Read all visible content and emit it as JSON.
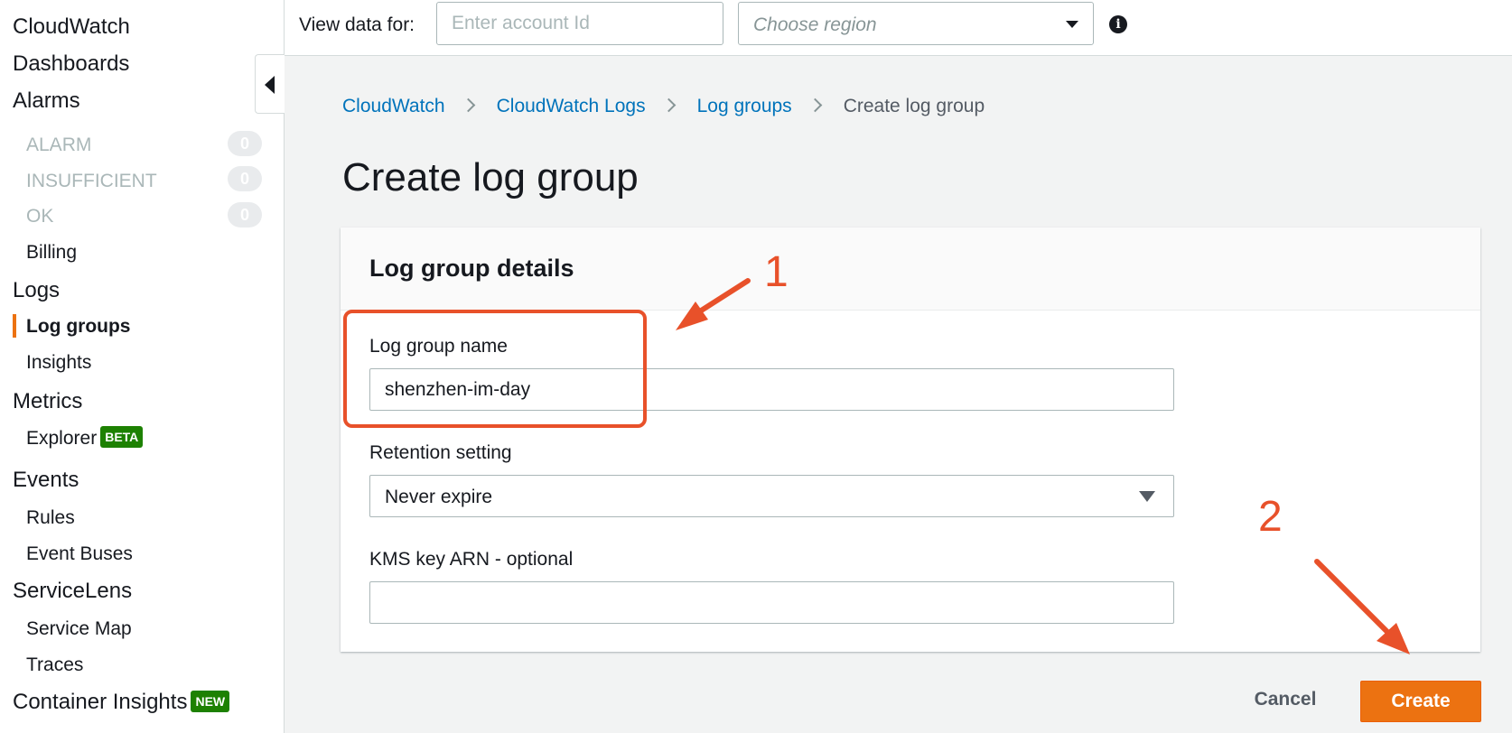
{
  "topbar": {
    "view_data_label": "View data for:",
    "account_placeholder": "Enter account Id",
    "region_placeholder": "Choose region"
  },
  "sidebar": {
    "cloudwatch": "CloudWatch",
    "dashboards": "Dashboards",
    "alarms": "Alarms",
    "alarm_items": [
      {
        "label": "ALARM",
        "count": "0"
      },
      {
        "label": "INSUFFICIENT",
        "count": "0"
      },
      {
        "label": "OK",
        "count": "0"
      }
    ],
    "billing": "Billing",
    "logs": "Logs",
    "log_groups": "Log groups",
    "insights": "Insights",
    "metrics": "Metrics",
    "explorer": "Explorer",
    "explorer_badge": "BETA",
    "events": "Events",
    "rules": "Rules",
    "event_buses": "Event Buses",
    "servicelens": "ServiceLens",
    "service_map": "Service Map",
    "traces": "Traces",
    "container_insights": "Container Insights",
    "container_badge": "NEW"
  },
  "breadcrumb": {
    "items": [
      "CloudWatch",
      "CloudWatch Logs",
      "Log groups"
    ],
    "current": "Create log group"
  },
  "page": {
    "title": "Create log group"
  },
  "panel": {
    "title": "Log group details",
    "name_label": "Log group name",
    "name_value": "shenzhen-im-day",
    "retention_label": "Retention setting",
    "retention_value": "Never expire",
    "kms_label": "KMS key ARN - optional",
    "kms_value": ""
  },
  "actions": {
    "cancel": "Cancel",
    "create": "Create"
  },
  "annotations": {
    "step1": "1",
    "step2": "2"
  },
  "colors": {
    "accent": "#ec7211",
    "link": "#0073bb",
    "annotation": "#e8512a",
    "badge_green": "#1d8102"
  },
  "icons": {
    "collapse": "caret-left-icon",
    "region_dropdown": "caret-down-icon",
    "info": "info-icon",
    "breadcrumb_separator": "chevron-right-icon"
  }
}
